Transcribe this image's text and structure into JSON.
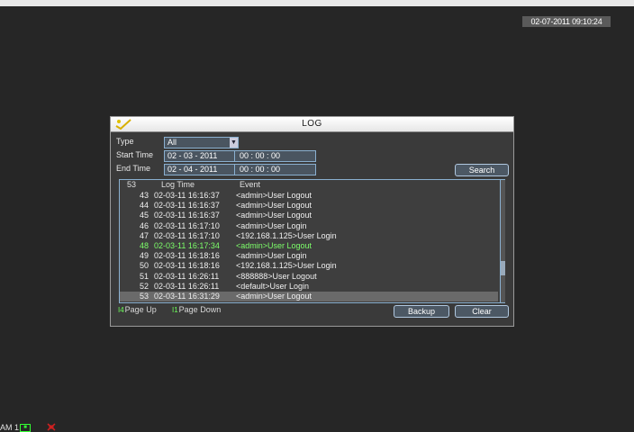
{
  "screen": {
    "clock": "02-07-2011 09:10:24"
  },
  "dialog": {
    "title": "LOG",
    "type_label": "Type",
    "type_value": "All",
    "start_label": "Start Time",
    "start_date": "02 - 03 - 2011",
    "start_time": "00 : 00 : 00",
    "end_label": "End Time",
    "end_date": "02 - 04 - 2011",
    "end_time": "00 : 00 : 00",
    "search_button": "Search",
    "columns": {
      "count": "53",
      "log_time": "Log Time",
      "event": "Event"
    },
    "rows": [
      {
        "no": "43",
        "time": "02-03-11 16:16:37",
        "event": "<admin>User Logout"
      },
      {
        "no": "44",
        "time": "02-03-11 16:16:37",
        "event": "<admin>User Logout"
      },
      {
        "no": "45",
        "time": "02-03-11 16:16:37",
        "event": "<admin>User Logout"
      },
      {
        "no": "46",
        "time": "02-03-11 16:17:10",
        "event": "<admin>User Login"
      },
      {
        "no": "47",
        "time": "02-03-11 16:17:10",
        "event": "<192.168.1.125>User Login"
      },
      {
        "no": "48",
        "time": "02-03-11 16:17:34",
        "event": "<admin>User Logout"
      },
      {
        "no": "49",
        "time": "02-03-11 16:18:16",
        "event": "<admin>User Login"
      },
      {
        "no": "50",
        "time": "02-03-11 16:18:16",
        "event": "<192.168.1.125>User Login"
      },
      {
        "no": "51",
        "time": "02-03-11 16:26:11",
        "event": "<888888>User Logout"
      },
      {
        "no": "52",
        "time": "02-03-11 16:26:11",
        "event": "<default>User Login"
      },
      {
        "no": "53",
        "time": "02-03-11 16:31:29",
        "event": "<admin>User Logout"
      }
    ],
    "page_up_key": "I4",
    "page_up": "Page Up",
    "page_down_key": "I1",
    "page_down": "Page Down",
    "backup_button": "Backup",
    "clear_button": "Clear"
  },
  "status_bar": {
    "channel": "AM 1",
    "rec_icon": "record-icon",
    "alarm_icon": "alarm-icon"
  },
  "colors": {
    "background": "#262626",
    "highlight_row": "#7dff6a",
    "border": "#8ab0d0"
  }
}
